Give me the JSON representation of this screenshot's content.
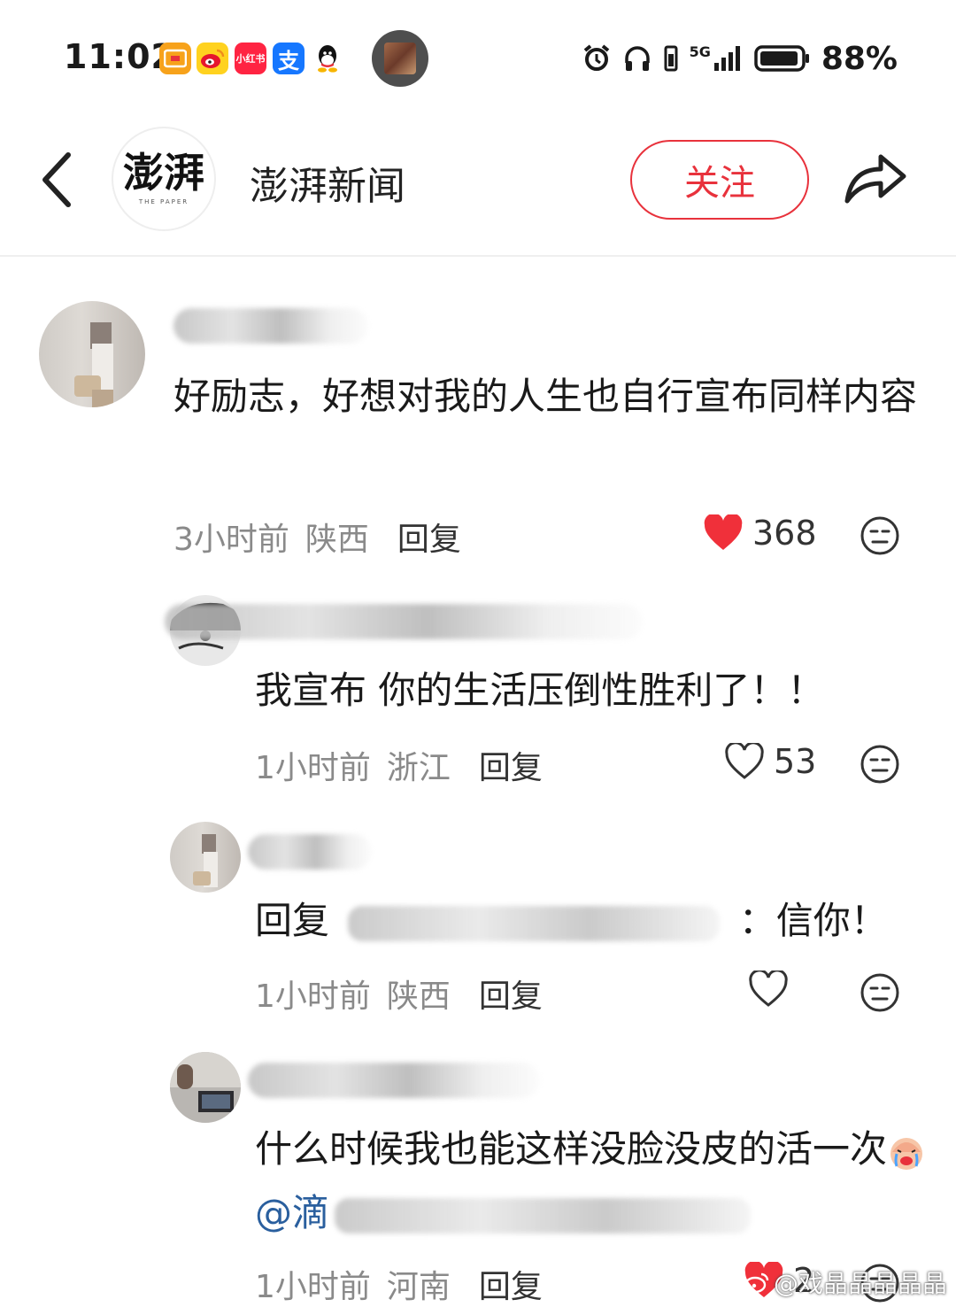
{
  "status_bar": {
    "time": "11:02",
    "app_icons": [
      "mail-icon",
      "weibo-icon",
      "xiaohongshu-icon",
      "alipay-icon",
      "qq-icon"
    ],
    "xiaohongshu_label": "小红书",
    "alipay_label": "支",
    "network": "5G",
    "battery": "88%"
  },
  "header": {
    "channel_name": "澎湃新闻",
    "logo_text": "澎湃",
    "logo_subtext": "THE PAPER",
    "follow_label": "关注"
  },
  "comments": [
    {
      "text": "好励志，好想对我的人生也自行宣布同样内容",
      "time": "3小时前",
      "region": "陕西",
      "reply_label": "回复",
      "likes": "368",
      "liked": true
    },
    {
      "text": "我宣布 你的生活压倒性胜利了！！",
      "time": "1小时前",
      "region": "浙江",
      "reply_label": "回复",
      "likes": "53",
      "liked": false
    },
    {
      "reply_prefix": "回复",
      "text": "：信你！",
      "time": "1小时前",
      "region": "陕西",
      "reply_label": "回复",
      "likes": "",
      "liked": false
    },
    {
      "text": "什么时候我也能这样没脸没皮的活一次",
      "mention": "@滴",
      "time": "1小时前",
      "region": "河南",
      "reply_label": "回复",
      "likes": "2",
      "liked": true
    }
  ],
  "watermark": "@戏晶晶晶晶晶",
  "colors": {
    "accent": "#e8323c",
    "meta": "#8a8a8a",
    "text": "#1a1a1a"
  }
}
